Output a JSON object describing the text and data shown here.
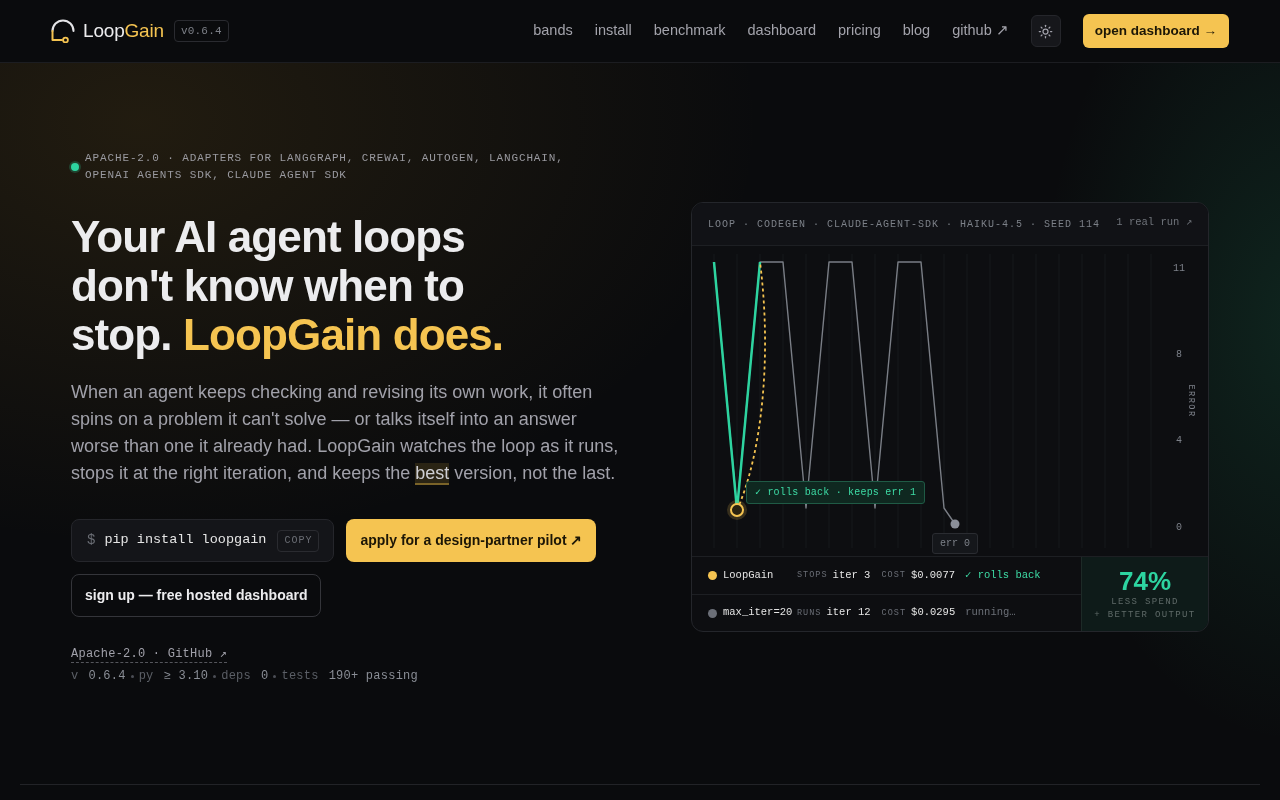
{
  "nav": {
    "brand": {
      "name": "Loop",
      "name_accent": "Gain"
    },
    "version": "v0.6.4",
    "links": [
      {
        "label": "bands"
      },
      {
        "label": "install"
      },
      {
        "label": "benchmark"
      },
      {
        "label": "dashboard"
      },
      {
        "label": "pricing"
      },
      {
        "label": "blog"
      },
      {
        "label": "github ↗"
      }
    ],
    "cta": "open dashboard →"
  },
  "hero": {
    "badge": "APACHE-2.0 · ADAPTERS FOR LANGGRAPH, CREWAI, AUTOGEN, LANGCHAIN, OPENAI AGENTS SDK, CLAUDE AGENT SDK",
    "headline": "Your AI agent loops don't know when to stop.",
    "headline_accent": "LoopGain does.",
    "intro": {
      "before": "When an agent keeps checking and revising its own work, it often spins on a problem it can't solve — or talks itself into an answer worse than one it already had. LoopGain watches the loop as it runs, stops it at the right iteration, and keeps the ",
      "highlight": "best",
      "after": " version, not the last."
    },
    "install": {
      "prompt": "$",
      "command": "pip install loopgain",
      "copy_label": "COPY"
    },
    "primary_action": "apply for a design-partner pilot ↗",
    "secondary_action": "sign up — free hosted dashboard",
    "license_link": "Apache-2.0 · GitHub ↗",
    "stats": [
      {
        "label": "v",
        "value": "0.6.4"
      },
      {
        "label": "py",
        "value": "≥ 3.10"
      },
      {
        "label": "deps",
        "value": "0"
      },
      {
        "label": "tests",
        "value": "190+ passing"
      }
    ]
  },
  "run_card": {
    "title": "LOOP · CODEGEN · CLAUDE-AGENT-SDK · HAIKU-4.5 · SEED 114",
    "link": "1 real run ↗",
    "plot": {
      "axis_title": "ERROR",
      "tick_labels": [
        "11",
        "8",
        "4",
        "0"
      ],
      "callout": "✓ rolls back · keeps err 1",
      "end_tag": "err 0"
    },
    "runs": [
      {
        "name": "LoopGain",
        "color": "#f5c451",
        "metric_label": "STOPS",
        "iteration": "iter 3",
        "cost_label": "COST",
        "cost": "$0.0077",
        "status": "✓ rolls back",
        "kind": "success"
      },
      {
        "name": "max_iter=20",
        "color": "#6b6f78",
        "metric_label": "RUNS",
        "iteration": "iter 12",
        "cost_label": "COST",
        "cost": "$0.0295",
        "status": "running…",
        "kind": "pending"
      }
    ],
    "summary": {
      "value": "74%",
      "caption_lines": [
        "LESS SPEND",
        "+ BETTER OUTPUT"
      ]
    }
  }
}
